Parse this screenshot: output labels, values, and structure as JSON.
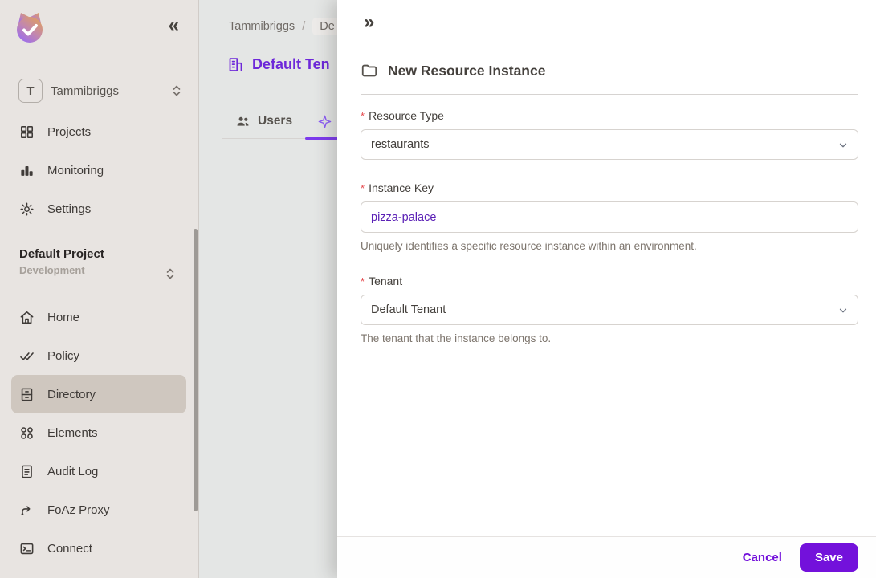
{
  "sidebar": {
    "logo_icon": "permit-cat-logo",
    "collapse_icon": "«",
    "org": {
      "avatar_initial": "T",
      "name": "Tammibriggs"
    },
    "top_items": [
      {
        "icon": "grid-icon",
        "label": "Projects"
      },
      {
        "icon": "bar-chart-icon",
        "label": "Monitoring"
      },
      {
        "icon": "gear-icon",
        "label": "Settings"
      }
    ],
    "project": {
      "name": "Default Project",
      "environment": "Development"
    },
    "nav_items": [
      {
        "icon": "home-icon",
        "label": "Home",
        "active": false
      },
      {
        "icon": "double-check-icon",
        "label": "Policy",
        "active": false
      },
      {
        "icon": "archive-icon",
        "label": "Directory",
        "active": true
      },
      {
        "icon": "circles-icon",
        "label": "Elements",
        "active": false
      },
      {
        "icon": "document-icon",
        "label": "Audit Log",
        "active": false
      },
      {
        "icon": "route-arrow-icon",
        "label": "FoAz Proxy",
        "active": false
      },
      {
        "icon": "terminal-icon",
        "label": "Connect",
        "active": false
      }
    ]
  },
  "main": {
    "breadcrumb": {
      "items": [
        "Tammibriggs",
        "De"
      ],
      "separator": "/"
    },
    "page_title": "Default Ten",
    "tabs": [
      {
        "icon": "users-icon",
        "label": "Users",
        "active": false
      },
      {
        "icon": "sparkle-icon",
        "label": "",
        "active": true
      }
    ]
  },
  "drawer": {
    "expand_icon": "»",
    "title_icon": "folder-icon",
    "title": "New Resource Instance",
    "required_marker": "*",
    "fields": [
      {
        "label": "Resource Type",
        "required": true,
        "type": "select",
        "value": "restaurants",
        "helper": ""
      },
      {
        "label": "Instance Key",
        "required": true,
        "type": "text",
        "value": "pizza-palace",
        "helper": "Uniquely identifies a specific resource instance within an environment."
      },
      {
        "label": "Tenant",
        "required": true,
        "type": "select",
        "value": "Default Tenant",
        "helper": "The tenant that the instance belongs to."
      }
    ],
    "footer": {
      "cancel_label": "Cancel",
      "save_label": "Save"
    }
  },
  "colors": {
    "accent_purple": "#7311db",
    "title_purple": "#6d28d9",
    "tab_underline_purple": "#7c3aed",
    "input_value_purple": "#5b21b6",
    "required_red": "#e5484d",
    "sidebar_bg": "#e8e4e1",
    "sidebar_active_bg": "#cfc7bf",
    "main_bg": "#e4e6e5"
  }
}
